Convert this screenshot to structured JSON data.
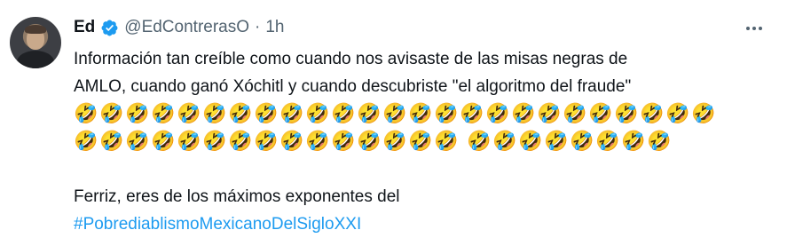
{
  "tweet": {
    "author_name": "Ed",
    "handle": "@EdContrerasO",
    "separator": "·",
    "time": "1h",
    "text_line1": "Información tan creíble como cuando nos avisaste de las misas negras de",
    "text_line2": "AMLO, cuando ganó Xóchitl y cuando descubriste \"el algoritmo del fraude\"",
    "emoji_char": "🤣",
    "emoji_row1_count": 25,
    "emoji_row2_group1_count": 15,
    "emoji_row2_group2_count": 8,
    "text_line3": "Ferriz, eres de los máximos exponentes del",
    "hashtag": "#PobrediablismoMexicanoDelSigloXXI"
  },
  "icons": {
    "verified": "verified-badge-icon",
    "more": "more-options-icon",
    "avatar": "user-avatar"
  },
  "colors": {
    "text": "#0f1419",
    "muted": "#536471",
    "link": "#1d9bf0",
    "verified": "#1d9bf0"
  }
}
